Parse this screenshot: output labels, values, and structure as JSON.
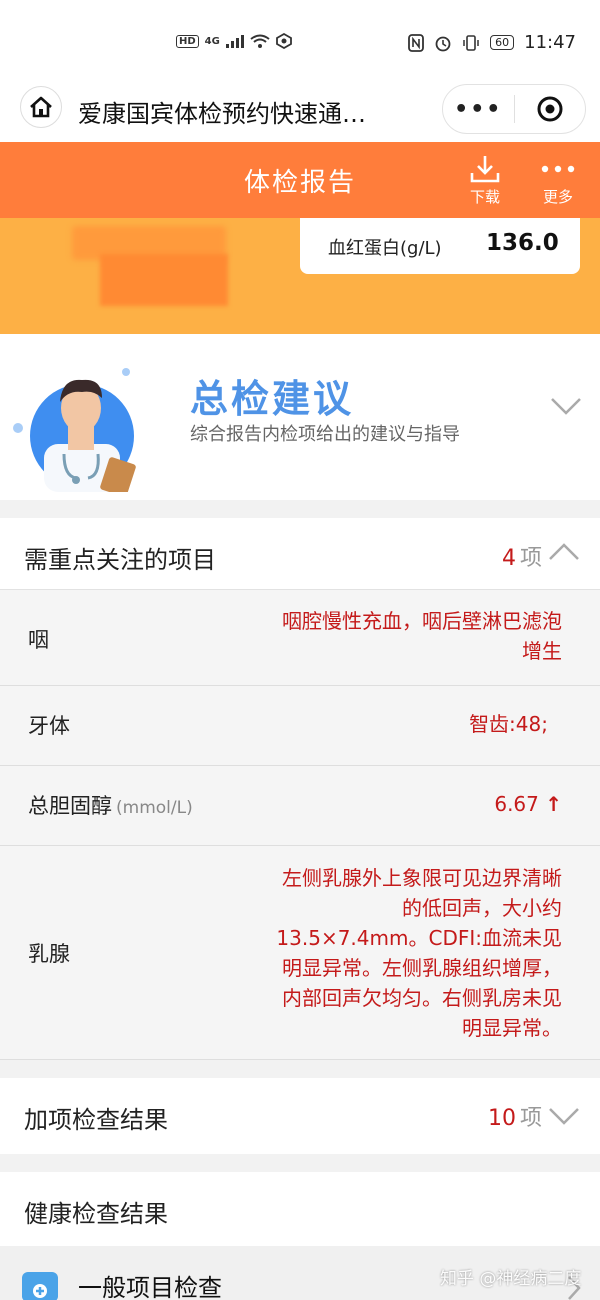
{
  "status_bar": {
    "network_badge": "HD",
    "network_type": "4G",
    "battery": "60",
    "time": "11:47"
  },
  "nav": {
    "title": "爱康国宾体检预约快速通…",
    "more_label": "•••"
  },
  "report_bar": {
    "title": "体检报告",
    "download_label": "下载",
    "more_label": "更多"
  },
  "hero": {
    "metric_label": "血红蛋白(g/L)",
    "metric_value": "136.0"
  },
  "advice": {
    "title": "总检建议",
    "subtitle": "综合报告内检项给出的建议与指导"
  },
  "focus": {
    "title": "需重点关注的项目",
    "count": "4",
    "unit": "项",
    "items": [
      {
        "name": "咽",
        "unit": "",
        "value": "咽腔慢性充血，咽后壁淋巴滤泡增生",
        "arrow": ""
      },
      {
        "name": "牙体",
        "unit": "",
        "value": "智齿:48;",
        "arrow": ""
      },
      {
        "name": "总胆固醇",
        "unit": "(mmol/L)",
        "value": "6.67",
        "arrow": "↑"
      },
      {
        "name": "乳腺",
        "unit": "",
        "value": "左侧乳腺外上象限可见边界清晰的低回声，大小约13.5×7.4mm。CDFI:血流未见明显异常。左侧乳腺组织增厚，内部回声欠均匀。右侧乳房未见明显异常。",
        "arrow": ""
      }
    ]
  },
  "extra": {
    "title": "加项检查结果",
    "count": "10",
    "unit": "项"
  },
  "health": {
    "title": "健康检查结果"
  },
  "general": {
    "label": "一般项目检查"
  },
  "watermark": "知乎 @神经病二度",
  "colors": {
    "accent_orange": "#ff7d3b",
    "hero_yellow": "#fdb045",
    "alert_red": "#c41a1a",
    "advice_blue": "#4f93e6"
  },
  "icons": {
    "home": "home-icon",
    "download": "download-icon",
    "more": "more-dots-icon",
    "target": "target-icon",
    "doctor": "doctor-illustration",
    "chevron_down": "chevron-down-icon",
    "chevron_up": "chevron-up-icon",
    "medical_kit": "medical-kit-icon"
  }
}
